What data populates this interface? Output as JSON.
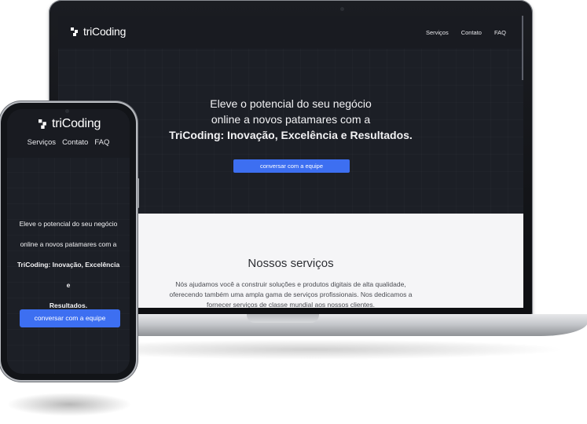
{
  "brand": {
    "name": "triCoding"
  },
  "nav": [
    "Serviços",
    "Contato",
    "FAQ"
  ],
  "hero": {
    "line1": "Eleve o potencial do seu negócio",
    "line2": "online a novos patamares com a",
    "line3": "TriCoding: Inovação, Excelência e Resultados.",
    "cta": "conversar com a equipe"
  },
  "mobile_hero": {
    "line1": "Eleve o potencial do seu negócio",
    "line2": "online a novos patamares com a",
    "line3": "TriCoding: Inovação, Excelência e",
    "line4": "Resultados."
  },
  "services": {
    "title": "Nossos serviços",
    "line1": "Nós ajudamos você a construir soluções e produtos digitais de alta qualidade,",
    "line2": "oferecendo também uma ampla gama de serviços profissionais. Nos dedicamos a",
    "line3": "fornecer serviços de classe mundial aos nossos clientes."
  },
  "colors": {
    "background_dark": "#1c1f26",
    "nav_dark": "#191b21",
    "accent": "#3d6ff1",
    "services_bg": "#f5f5f7"
  }
}
